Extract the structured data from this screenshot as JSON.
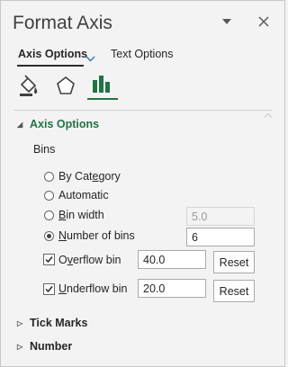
{
  "header": {
    "title": "Format Axis",
    "tabs": {
      "selected": "Axis Options",
      "other": "Text Options"
    }
  },
  "sections": {
    "axis_options": "Axis Options",
    "tick_marks": "Tick Marks",
    "number": "Number"
  },
  "bins": {
    "group_label": "Bins",
    "by_category": "By Category",
    "automatic": "Automatic",
    "bin_width": "Bin width",
    "bin_width_value": "5.0",
    "number_of_bins": "Number of bins",
    "number_of_bins_value": "6",
    "selected_option": "number_of_bins",
    "overflow": {
      "label": "Overflow bin",
      "checked": true,
      "value": "40.0"
    },
    "underflow": {
      "label": "Underflow bin",
      "checked": true,
      "value": "20.0"
    },
    "reset_label": "Reset"
  },
  "colors": {
    "accent": "#217346"
  }
}
